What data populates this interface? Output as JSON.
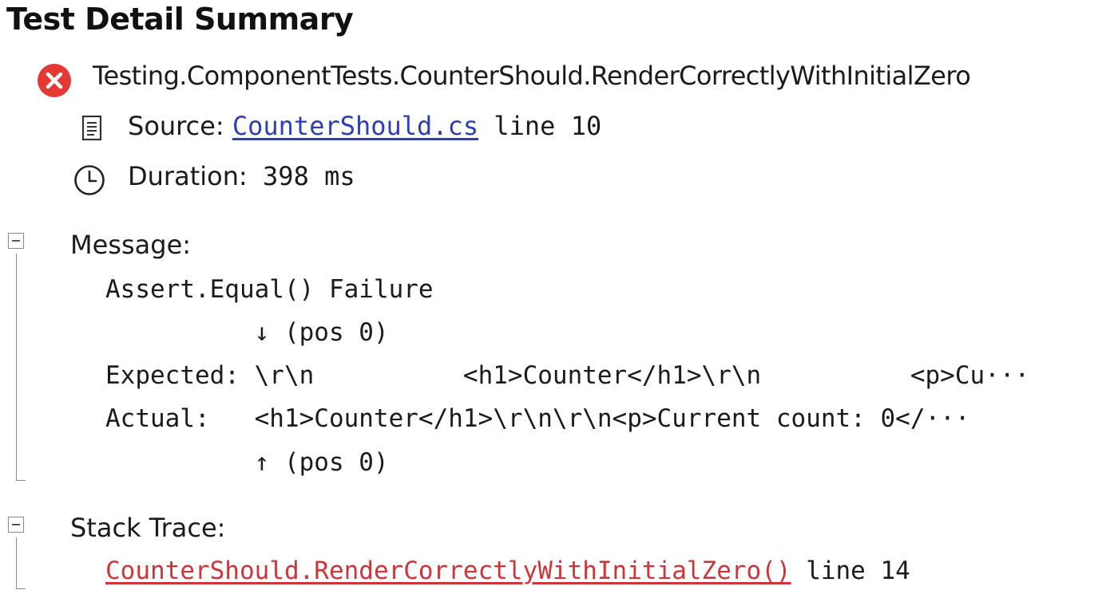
{
  "page": {
    "title": "Test Detail Summary"
  },
  "test": {
    "status_icon": "error-circle-icon",
    "name": "Testing.ComponentTests.CounterShould.RenderCorrectlyWithInitialZero"
  },
  "source": {
    "label": "Source:",
    "file": "CounterShould.cs",
    "line_text": " line 10"
  },
  "duration": {
    "label": "Duration:",
    "value": " 398 ms"
  },
  "message": {
    "header": "Message:",
    "lines": [
      "Assert.Equal() Failure",
      "          ↓ (pos 0)",
      "Expected: \\r\\n          <h1>Counter</h1>\\r\\n          <p>Cu···",
      "Actual:   <h1>Counter</h1>\\r\\n\\r\\n<p>Current count: 0</···",
      "          ↑ (pos 0)"
    ]
  },
  "stack_trace": {
    "header": "Stack Trace:",
    "method": "CounterShould.RenderCorrectlyWithInitialZero()",
    "line_text": " line 14"
  },
  "colors": {
    "error_red": "#e53935",
    "link_blue": "#2c3fb3",
    "stack_red": "#d13438",
    "tree_gray": "#8a8a8a"
  }
}
